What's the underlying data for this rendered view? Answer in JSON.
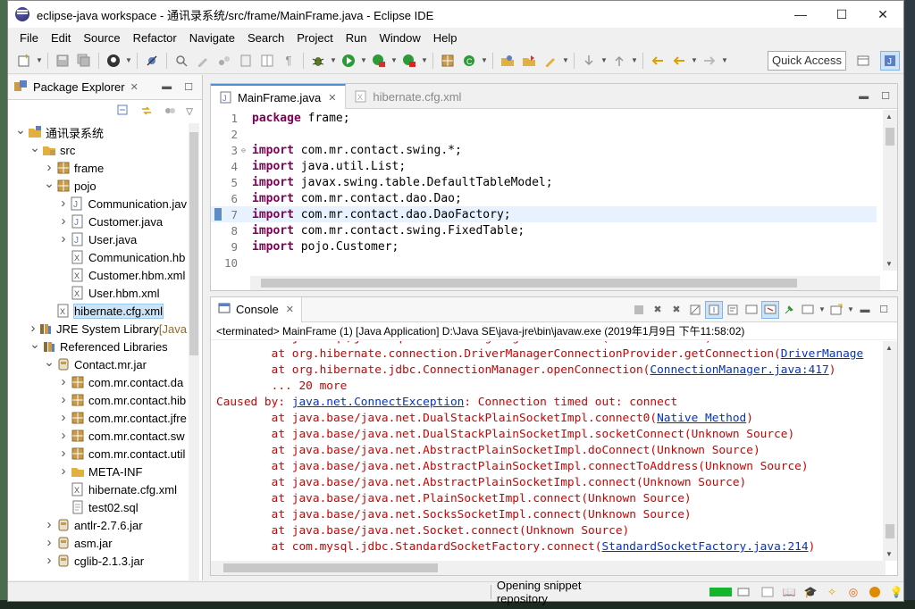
{
  "window": {
    "title": "eclipse-java workspace - 通讯录系统/src/frame/MainFrame.java - Eclipse IDE",
    "minimize": "—",
    "maximize": "☐",
    "close": "✕"
  },
  "menu": [
    "File",
    "Edit",
    "Source",
    "Refactor",
    "Navigate",
    "Search",
    "Project",
    "Run",
    "Window",
    "Help"
  ],
  "toolbar": {
    "quick_access": "Quick Access"
  },
  "package_explorer": {
    "title": "Package Explorer",
    "tree": [
      {
        "label": "通讯录系统",
        "depth": 0,
        "toggle": "down",
        "icon": "project"
      },
      {
        "label": "src",
        "depth": 1,
        "toggle": "down",
        "icon": "srcfolder"
      },
      {
        "label": "frame",
        "depth": 2,
        "toggle": "right",
        "icon": "package"
      },
      {
        "label": "pojo",
        "depth": 2,
        "toggle": "down",
        "icon": "package"
      },
      {
        "label": "Communication.jav",
        "depth": 3,
        "toggle": "right",
        "icon": "java"
      },
      {
        "label": "Customer.java",
        "depth": 3,
        "toggle": "right",
        "icon": "java"
      },
      {
        "label": "User.java",
        "depth": 3,
        "toggle": "right",
        "icon": "java"
      },
      {
        "label": "Communication.hb",
        "depth": 3,
        "toggle": "",
        "icon": "xml"
      },
      {
        "label": "Customer.hbm.xml",
        "depth": 3,
        "toggle": "",
        "icon": "xml"
      },
      {
        "label": "User.hbm.xml",
        "depth": 3,
        "toggle": "",
        "icon": "xml"
      },
      {
        "label": "hibernate.cfg.xml",
        "depth": 2,
        "toggle": "",
        "icon": "xml",
        "selected": true
      },
      {
        "label": "JRE System Library",
        "suffix": "[Java",
        "depth": 1,
        "toggle": "right",
        "icon": "lib"
      },
      {
        "label": "Referenced Libraries",
        "depth": 1,
        "toggle": "down",
        "icon": "lib"
      },
      {
        "label": "Contact.mr.jar",
        "depth": 2,
        "toggle": "down",
        "icon": "jar"
      },
      {
        "label": "com.mr.contact.da",
        "depth": 3,
        "toggle": "right",
        "icon": "package"
      },
      {
        "label": "com.mr.contact.hib",
        "depth": 3,
        "toggle": "right",
        "icon": "package"
      },
      {
        "label": "com.mr.contact.jfre",
        "depth": 3,
        "toggle": "right",
        "icon": "package"
      },
      {
        "label": "com.mr.contact.sw",
        "depth": 3,
        "toggle": "right",
        "icon": "package"
      },
      {
        "label": "com.mr.contact.util",
        "depth": 3,
        "toggle": "right",
        "icon": "package"
      },
      {
        "label": "META-INF",
        "depth": 3,
        "toggle": "right",
        "icon": "folder"
      },
      {
        "label": "hibernate.cfg.xml",
        "depth": 3,
        "toggle": "",
        "icon": "xml"
      },
      {
        "label": "test02.sql",
        "depth": 3,
        "toggle": "",
        "icon": "file"
      },
      {
        "label": "antlr-2.7.6.jar",
        "depth": 2,
        "toggle": "right",
        "icon": "jar"
      },
      {
        "label": "asm.jar",
        "depth": 2,
        "toggle": "right",
        "icon": "jar"
      },
      {
        "label": "cglib-2.1.3.jar",
        "depth": 2,
        "toggle": "right",
        "icon": "jar"
      }
    ]
  },
  "editor": {
    "tabs": [
      {
        "label": "MainFrame.java",
        "active": true
      },
      {
        "label": "hibernate.cfg.xml",
        "active": false
      }
    ],
    "lines": [
      {
        "num": "1",
        "kw": "package",
        "rest": " frame;"
      },
      {
        "num": "2",
        "kw": "",
        "rest": ""
      },
      {
        "num": "3",
        "kw": "import",
        "rest": " com.mr.contact.swing.*;",
        "fold": "⊖"
      },
      {
        "num": "4",
        "kw": "import",
        "rest": " java.util.List;"
      },
      {
        "num": "5",
        "kw": "import",
        "rest": " javax.swing.table.DefaultTableModel;"
      },
      {
        "num": "6",
        "kw": "import",
        "rest": " com.mr.contact.dao.Dao;"
      },
      {
        "num": "7",
        "kw": "import",
        "rest": " com.mr.contact.dao.DaoFactory;",
        "highlight": true
      },
      {
        "num": "8",
        "kw": "import",
        "rest": " com.mr.contact.swing.FixedTable;"
      },
      {
        "num": "9",
        "kw": "import",
        "rest": " pojo.Customer;"
      },
      {
        "num": "10",
        "kw": "",
        "rest": ""
      }
    ]
  },
  "console": {
    "title": "Console",
    "status": "<terminated> MainFrame (1) [Java Application] D:\\Java SE\\java-jre\\bin\\javaw.exe (2019年1月9日 下午11:58:02)",
    "lines": [
      {
        "pre": "        at java.sql/java.sql.DriverManager.getConnection(Unknown Source)",
        "link": "",
        "post": "",
        "cut": true
      },
      {
        "pre": "        at org.hibernate.connection.DriverManagerConnectionProvider.getConnection(",
        "link": "DriverManage",
        "post": ""
      },
      {
        "pre": "        at org.hibernate.jdbc.ConnectionManager.openConnection(",
        "link": "ConnectionManager.java:417",
        "post": ")"
      },
      {
        "pre": "        ... 20 more",
        "link": "",
        "post": ""
      },
      {
        "pre": "Caused by: ",
        "link": "java.net.ConnectException",
        "post": ": Connection timed out: connect"
      },
      {
        "pre": "        at java.base/java.net.DualStackPlainSocketImpl.connect0(",
        "link": "Native Method",
        "post": ")"
      },
      {
        "pre": "        at java.base/java.net.DualStackPlainSocketImpl.socketConnect(Unknown Source)",
        "link": "",
        "post": ""
      },
      {
        "pre": "        at java.base/java.net.AbstractPlainSocketImpl.doConnect(Unknown Source)",
        "link": "",
        "post": ""
      },
      {
        "pre": "        at java.base/java.net.AbstractPlainSocketImpl.connectToAddress(Unknown Source)",
        "link": "",
        "post": ""
      },
      {
        "pre": "        at java.base/java.net.AbstractPlainSocketImpl.connect(Unknown Source)",
        "link": "",
        "post": ""
      },
      {
        "pre": "        at java.base/java.net.PlainSocketImpl.connect(Unknown Source)",
        "link": "",
        "post": ""
      },
      {
        "pre": "        at java.base/java.net.SocksSocketImpl.connect(Unknown Source)",
        "link": "",
        "post": ""
      },
      {
        "pre": "        at java.base/java.net.Socket.connect(Unknown Source)",
        "link": "",
        "post": ""
      },
      {
        "pre": "        at com.mysql.jdbc.StandardSocketFactory.connect(",
        "link": "StandardSocketFactory.java:214",
        "post": ")"
      }
    ]
  },
  "statusbar": {
    "message": "Opening snippet repository"
  },
  "colors": {
    "keyword": "#7f0055",
    "error": "#d00000",
    "link": "#0033cc",
    "selection": "#cce4f7",
    "progress": "#13b52b"
  }
}
